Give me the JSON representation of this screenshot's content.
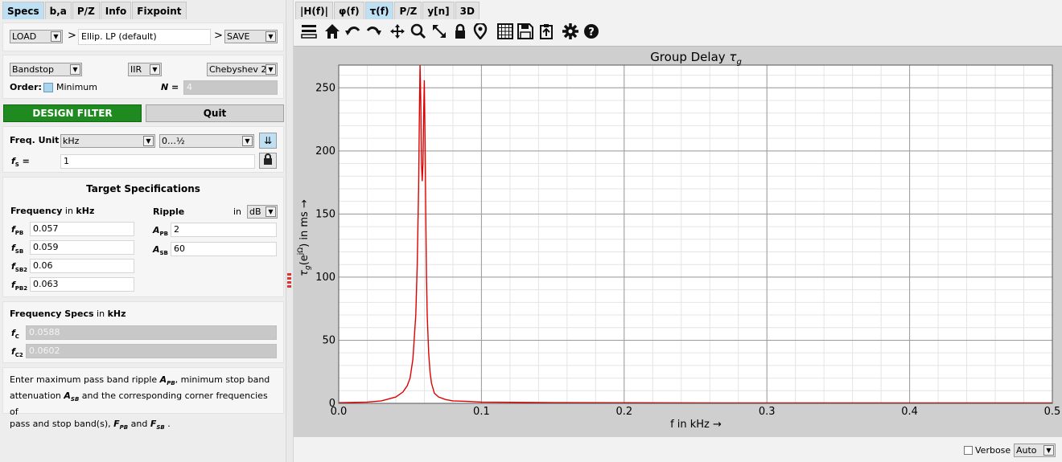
{
  "left_tabs": [
    "Specs",
    "b,a",
    "P/Z",
    "Info",
    "Fixpoint"
  ],
  "load": {
    "load_label": "LOAD",
    "arrow1": ">",
    "filter_name": "Ellip. LP (default)",
    "arrow2": ">",
    "save_label": "SAVE"
  },
  "filter_type": {
    "response": "Bandstop",
    "design": "IIR",
    "method": "Chebyshev 2",
    "order_label": "Order:",
    "minimum_label": "Minimum",
    "n_label": "N =",
    "n_value": "4"
  },
  "actions": {
    "design_label": "DESIGN FILTER",
    "quit_label": "Quit",
    "design_color": "#1f8a1f"
  },
  "freq_unit": {
    "label": "Freq. Unit",
    "unit": "kHz",
    "range": "0…½",
    "fs_value": "1"
  },
  "target": {
    "title": "Target Specifications",
    "freq_header": "Frequency",
    "in_word": "in",
    "freq_unit": "kHz",
    "ripple_header": "Ripple",
    "ripple_in": "in",
    "ripple_unit": "dB",
    "freqs": [
      {
        "sub": "PB",
        "value": "0.057"
      },
      {
        "sub": "SB",
        "value": "0.059"
      },
      {
        "sub": "SB2",
        "value": "0.06"
      },
      {
        "sub": "PB2",
        "value": "0.063"
      }
    ],
    "amps": [
      {
        "sub": "PB",
        "value": "2"
      },
      {
        "sub": "SB",
        "value": "60"
      }
    ]
  },
  "freq_specs": {
    "title": "Frequency Specs",
    "in_word": "in",
    "unit": "kHz",
    "fc_value": "0.0588",
    "fc2_value": "0.0602"
  },
  "help": {
    "t1": "Enter maximum pass band ripple ",
    "t2": ", minimum stop band",
    "t3": "attenuation ",
    "t4": " and the corresponding corner frequencies of",
    "t5": "pass and stop band(s), ",
    "t6": " and ",
    "t7": " ."
  },
  "right_tabs": [
    "|H(f)|",
    "φ(f)",
    "τ(f)",
    "P/Z",
    "y[n]",
    "3D"
  ],
  "toolbar_icons": [
    "menu-icon",
    "home-icon",
    "undo-icon",
    "redo-icon",
    "pan-icon",
    "zoom-icon",
    "autoscale-icon",
    "lock-icon",
    "marker-icon",
    "grid-icon",
    "save-icon",
    "export-icon",
    "settings-icon",
    "help-icon"
  ],
  "plot": {
    "title_text": "Group Delay",
    "xlabel_text": "f in kHz →",
    "ylabel_text": "in ms →",
    "trace_color": "#e00000"
  },
  "bottom": {
    "verbose_label": "Verbose",
    "mode": "Auto"
  },
  "chart_data": {
    "type": "line",
    "title": "Group Delay τg",
    "xlabel": "f in kHz →",
    "ylabel": "τg(e^jΩ) in ms →",
    "xlim": [
      0.0,
      0.5
    ],
    "ylim": [
      0,
      268
    ],
    "xticks": [
      "0.0",
      "0.1",
      "0.2",
      "0.3",
      "0.4",
      "0.5"
    ],
    "yticks": [
      "0",
      "50",
      "100",
      "150",
      "200",
      "250"
    ],
    "grid": true,
    "series": [
      {
        "x": [
          0.0,
          0.02,
          0.03,
          0.04,
          0.045,
          0.048,
          0.05,
          0.052,
          0.054,
          0.055,
          0.056,
          0.0565,
          0.057,
          0.0575,
          0.058,
          0.0585,
          0.059,
          0.0595,
          0.06,
          0.0605,
          0.061,
          0.0615,
          0.062,
          0.063,
          0.064,
          0.065,
          0.067,
          0.07,
          0.075,
          0.08,
          0.09,
          0.1,
          0.15,
          0.2,
          0.3,
          0.4,
          0.5
        ],
        "y": [
          0.5,
          1,
          2,
          5,
          9,
          14,
          20,
          35,
          70,
          110,
          170,
          225,
          268,
          240,
          190,
          176,
          190,
          230,
          256,
          210,
          150,
          100,
          70,
          40,
          25,
          16,
          8,
          5,
          3,
          2,
          1.5,
          1,
          0.6,
          0.5,
          0.3,
          0.3,
          0.3
        ]
      }
    ]
  }
}
